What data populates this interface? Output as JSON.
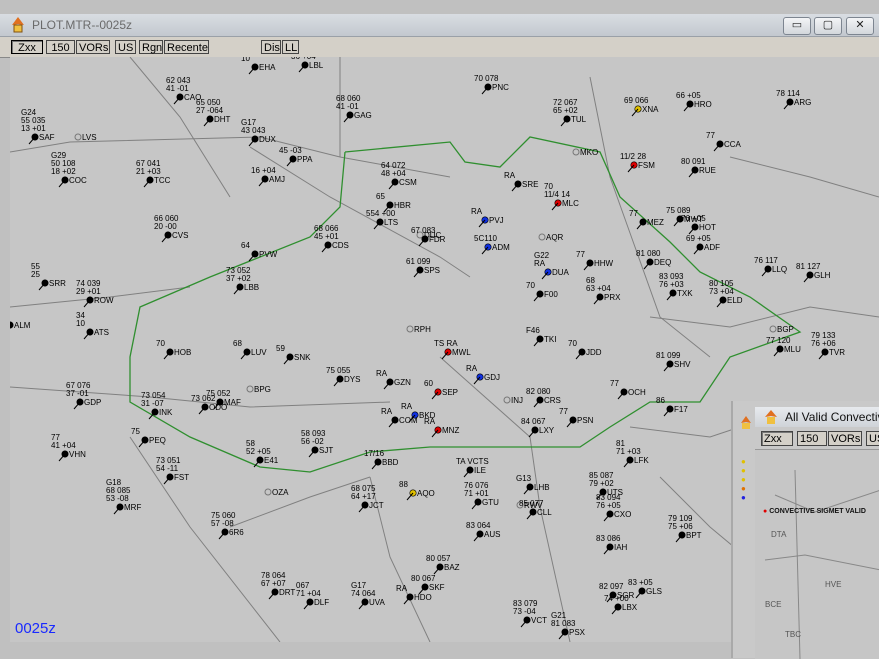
{
  "window": {
    "title": "PLOT.MTR--0025z",
    "buttons": {
      "minimize": "▭",
      "maximize": "▢",
      "close": "✕"
    }
  },
  "toolbar": {
    "items": [
      "Zxx",
      "150",
      "VORs",
      "US",
      "Rgn",
      "Recente",
      "Dis",
      "LL"
    ]
  },
  "map": {
    "timestamp": "0025z",
    "colors": {
      "background": "#c6c6c6",
      "convective_outline": "#2f8f2f",
      "boundaries": "#808080",
      "timestamp": "#1a2aff"
    },
    "region_labels": [
      "DUC",
      "AQR",
      "MKO",
      "RPH",
      "BPG",
      "OZA",
      "INJ",
      "RWV",
      "BGP",
      "LVS"
    ],
    "stations": [
      {
        "id": "EHA",
        "lines": [
          "33",
          "10"
        ]
      },
      {
        "id": "LBL",
        "lines": [
          "36 +04"
        ]
      },
      {
        "id": "CAO",
        "lines": [
          "62 043",
          "41 -01"
        ]
      },
      {
        "id": "DHT",
        "lines": [
          "65 050",
          "27 -064"
        ]
      },
      {
        "id": "GAG",
        "lines": [
          "68 060",
          "41 -01"
        ]
      },
      {
        "id": "PNC",
        "lines": [
          "70 078"
        ]
      },
      {
        "id": "SAF",
        "lines": [
          "G24",
          "55 035",
          "13 +01"
        ]
      },
      {
        "id": "DUX",
        "lines": [
          "G17",
          "43 043"
        ]
      },
      {
        "id": "PPA",
        "lines": [
          "45 -03"
        ]
      },
      {
        "id": "TCC",
        "lines": [
          "67 041",
          "21 +03"
        ]
      },
      {
        "id": "COC",
        "lines": [
          "G29",
          "50 108",
          "18 +02"
        ]
      },
      {
        "id": "AMJ",
        "lines": [
          "16 +04"
        ]
      },
      {
        "id": "TUL",
        "lines": [
          "72 067",
          "65 +02"
        ]
      },
      {
        "id": "XNA",
        "lines": [
          "69 066"
        ]
      },
      {
        "id": "HRO",
        "lines": [
          "66 +05"
        ]
      },
      {
        "id": "ARG",
        "lines": [
          "78 114"
        ]
      },
      {
        "id": "CCA",
        "lines": [
          "77"
        ]
      },
      {
        "id": "SRE",
        "lines": [
          "RA"
        ]
      },
      {
        "id": "MLC",
        "lines": [
          "70",
          "11/4 14"
        ]
      },
      {
        "id": "FSM",
        "lines": [
          "11/2 28"
        ]
      },
      {
        "id": "RUE",
        "lines": [
          "80 091"
        ]
      },
      {
        "id": "CSM",
        "lines": [
          "64 072",
          "48 +04"
        ]
      },
      {
        "id": "HBR",
        "lines": [
          "65"
        ]
      },
      {
        "id": "LTS",
        "lines": [
          "554 +00"
        ]
      },
      {
        "id": "PVJ",
        "lines": [
          "RA"
        ]
      },
      {
        "id": "CVS",
        "lines": [
          "66 060",
          "20 -00"
        ]
      },
      {
        "id": "CDS",
        "lines": [
          "68 066",
          "45 +01"
        ]
      },
      {
        "id": "FDR",
        "lines": [
          "67 083"
        ]
      },
      {
        "id": "ADM",
        "lines": [
          "5C110"
        ]
      },
      {
        "id": "MEZ",
        "lines": [
          "77"
        ]
      },
      {
        "id": "MWT",
        "lines": [
          "75 089"
        ]
      },
      {
        "id": "HOT",
        "lines": [
          "76 +05"
        ]
      },
      {
        "id": "ADF",
        "lines": [
          "69 +05"
        ]
      },
      {
        "id": "PVW",
        "lines": [
          "64"
        ]
      },
      {
        "id": "SPS",
        "lines": [
          "61 099"
        ]
      },
      {
        "id": "DUA",
        "lines": [
          "G22",
          "RA"
        ]
      },
      {
        "id": "HHW",
        "lines": [
          "77"
        ]
      },
      {
        "id": "DEQ",
        "lines": [
          "81 080"
        ]
      },
      {
        "id": "LLQ",
        "lines": [
          "76 117"
        ]
      },
      {
        "id": "GLH",
        "lines": [
          "81 127"
        ]
      },
      {
        "id": "SRR",
        "lines": [
          "55",
          "25"
        ]
      },
      {
        "id": "ROW",
        "lines": [
          "74 039",
          "29 +01"
        ]
      },
      {
        "id": "LBB",
        "lines": [
          "73 052",
          "37 +02"
        ]
      },
      {
        "id": "F00",
        "lines": [
          "70"
        ]
      },
      {
        "id": "PRX",
        "lines": [
          "68",
          "63 +04"
        ]
      },
      {
        "id": "TXK",
        "lines": [
          "83 093",
          "76 +03"
        ]
      },
      {
        "id": "ELD",
        "lines": [
          "80 105",
          "73 +04"
        ]
      },
      {
        "id": "ALM",
        "lines": [
          "31"
        ]
      },
      {
        "id": "ATS",
        "lines": [
          "34",
          "10"
        ]
      },
      {
        "id": "HOB",
        "lines": [
          "70"
        ]
      },
      {
        "id": "LUV",
        "lines": [
          "68"
        ]
      },
      {
        "id": "SNK",
        "lines": [
          "59"
        ]
      },
      {
        "id": "MWL",
        "lines": [
          "TS RA"
        ]
      },
      {
        "id": "TKI",
        "lines": [
          "F46"
        ]
      },
      {
        "id": "JDD",
        "lines": [
          "70"
        ]
      },
      {
        "id": "MLU",
        "lines": [
          "77 120"
        ]
      },
      {
        "id": "TVR",
        "lines": [
          "79 133",
          "76 +06"
        ]
      },
      {
        "id": "DYS",
        "lines": [
          "75 055"
        ]
      },
      {
        "id": "GZN",
        "lines": [
          "RA"
        ]
      },
      {
        "id": "GDJ",
        "lines": [
          "RA"
        ]
      },
      {
        "id": "INK",
        "lines": [
          "73 054",
          "31 -07"
        ]
      },
      {
        "id": "ODO",
        "lines": [
          "73 062"
        ]
      },
      {
        "id": "GDP",
        "lines": [
          "67 076",
          "37 -01"
        ]
      },
      {
        "id": "MAF",
        "lines": [
          "75 052"
        ]
      },
      {
        "id": "SEP",
        "lines": [
          "60"
        ]
      },
      {
        "id": "CRS",
        "lines": [
          "82 080"
        ]
      },
      {
        "id": "PSN",
        "lines": [
          "77"
        ]
      },
      {
        "id": "OCH",
        "lines": [
          "77"
        ]
      },
      {
        "id": "SHV",
        "lines": [
          "81 099"
        ]
      },
      {
        "id": "F17",
        "lines": [
          "86"
        ]
      },
      {
        "id": "PEQ",
        "lines": [
          "75"
        ]
      },
      {
        "id": "COM",
        "lines": [
          "RA"
        ]
      },
      {
        "id": "BKD",
        "lines": [
          "RA"
        ]
      },
      {
        "id": "MNZ",
        "lines": [
          "RA"
        ]
      },
      {
        "id": "LXY",
        "lines": [
          "84 067"
        ]
      },
      {
        "id": "SJT",
        "lines": [
          "58 093",
          "56 -02"
        ]
      },
      {
        "id": "VHN",
        "lines": [
          "77",
          "41 +04"
        ]
      },
      {
        "id": "E41",
        "lines": [
          "58",
          "52 +05"
        ]
      },
      {
        "id": "FST",
        "lines": [
          "73 051",
          "54 -11"
        ]
      },
      {
        "id": "BBD",
        "lines": [
          "17/16"
        ]
      },
      {
        "id": "ILE",
        "lines": [
          "TA VCTS"
        ]
      },
      {
        "id": "LFK",
        "lines": [
          "81",
          "71 +03"
        ]
      },
      {
        "id": "MRF",
        "lines": [
          "G18",
          "68 085",
          "53 -08"
        ]
      },
      {
        "id": "JCT",
        "lines": [
          "68 075",
          "64 +17"
        ]
      },
      {
        "id": "AQO",
        "lines": [
          "88"
        ]
      },
      {
        "id": "GTU",
        "lines": [
          "76 076",
          "71 +01"
        ]
      },
      {
        "id": "LHB",
        "lines": [
          "G13"
        ]
      },
      {
        "id": "CLL",
        "lines": [
          "85 077"
        ]
      },
      {
        "id": "UTS",
        "lines": [
          "85 087",
          "79 +02"
        ]
      },
      {
        "id": "AUS",
        "lines": [
          "83 064"
        ]
      },
      {
        "id": "CXO",
        "lines": [
          "83 094",
          "76 +05"
        ]
      },
      {
        "id": "6R6",
        "lines": [
          "75 060",
          "57 -08"
        ]
      },
      {
        "id": "BPT",
        "lines": [
          "79 109",
          "75 +06"
        ]
      },
      {
        "id": "IAH",
        "lines": [
          "83 086"
        ]
      },
      {
        "id": "BAZ",
        "lines": [
          "80 057"
        ]
      },
      {
        "id": "DRT",
        "lines": [
          "78 064",
          "67 +07"
        ]
      },
      {
        "id": "DLF",
        "lines": [
          "067",
          "71 +04"
        ]
      },
      {
        "id": "UVA",
        "lines": [
          "G17",
          "74 064"
        ]
      },
      {
        "id": "HDO",
        "lines": [
          "RA"
        ]
      },
      {
        "id": "SKF",
        "lines": [
          "80 067"
        ]
      },
      {
        "id": "SGR",
        "lines": [
          "82 097"
        ]
      },
      {
        "id": "LBX",
        "lines": [
          "74 +00"
        ]
      },
      {
        "id": "GLS",
        "lines": [
          "83 +05"
        ]
      },
      {
        "id": "VCT",
        "lines": [
          "83 079",
          "73 -04"
        ]
      },
      {
        "id": "PSX",
        "lines": [
          "G21",
          "81 083"
        ]
      }
    ]
  },
  "popup": {
    "title": "All Valid Convective",
    "toolbar": [
      "Zxx",
      "150",
      "VORs",
      "US"
    ],
    "legend": "CONVECTIVE SIGMET VALID",
    "map_labels": [
      "DTA",
      "HVE",
      "BCE",
      "TBC"
    ],
    "colors": {
      "legend_dot": "#e00000"
    }
  }
}
